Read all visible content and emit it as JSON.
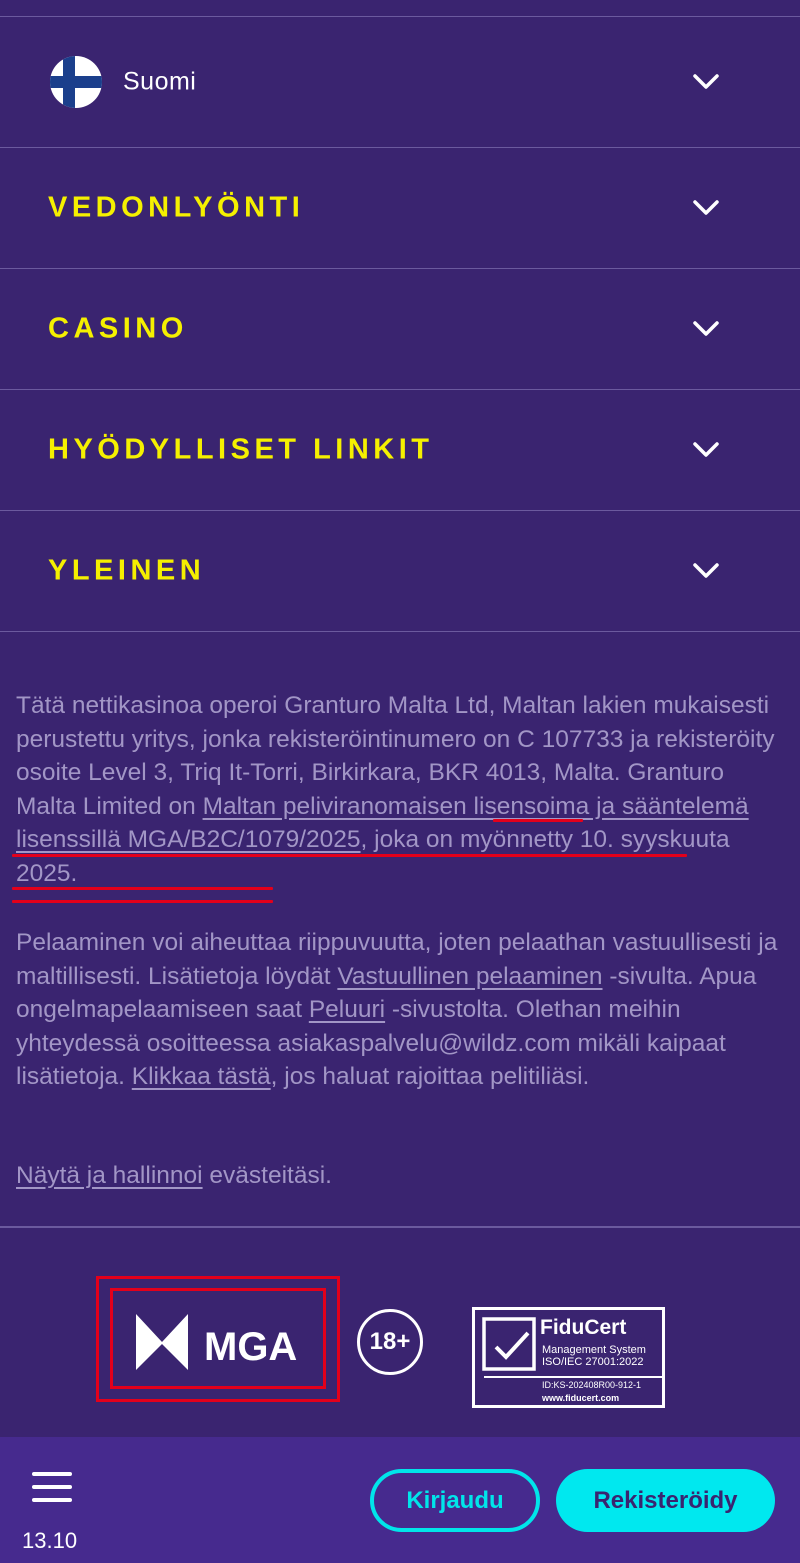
{
  "language": {
    "label": "Suomi",
    "flag_icon": "finland-flag-icon"
  },
  "accordion": [
    {
      "label": "VEDONLYÖNTI"
    },
    {
      "label": "CASINO"
    },
    {
      "label": "HYÖDYLLISET LINKIT"
    },
    {
      "label": "YLEINEN"
    }
  ],
  "info": {
    "p1_text_a": "Tätä nettikasinoa operoi Granturo Malta Ltd, Maltan lakien mukaisesti perustettu yritys, jonka rekisteröintinumero on C 107733 ja rekisteröity osoite Level 3, Triq It-Torri, Birkirkara, BKR 4013, Malta. Granturo Malta Limited on ",
    "p1_link": "Maltan peliviranomaisen lisensoima ja sääntelemä lisenssillä MGA/B2C/1079/2025",
    "p1_text_b": ", joka on myönnetty 10. syyskuuta 2025.",
    "p2_text_a": "Pelaaminen voi aiheuttaa riippuvuutta, joten pelaathan vastuullisesti ja maltillisesti. Lisätietoja löydät ",
    "p2_link1": "Vastuullinen pelaaminen",
    "p2_text_b": " -sivulta. Apua ongelmapelaamiseen saat ",
    "p2_link2": "Peluuri",
    "p2_text_c": " -sivustolta. Olethan meihin yhteydessä osoitteessa asiakaspalvelu@wildz.com mikäli kaipaat lisätietoja. ",
    "p2_link3": "Klikkaa tästä",
    "p2_text_d": ", jos haluat rajoittaa pelitiliäsi.",
    "p3_link": "Näytä ja hallinnoi",
    "p3_text": " evästeitäsi."
  },
  "badges": {
    "mga": "MGA",
    "age": "18+",
    "fiducert_title": "FiduCert",
    "fiducert_line1": "Management System",
    "fiducert_line2": "ISO/IEC 27001:2022",
    "fiducert_id": "ID:KS-202408R00-912-1",
    "fiducert_url": "www.fiducert.com"
  },
  "bottom_bar": {
    "version": "13.10",
    "login": "Kirjaudu",
    "register": "Rekisteröidy"
  },
  "colors": {
    "background": "#3a2470",
    "accent_yellow": "#f5f000",
    "accent_cyan": "#00e5ea",
    "annotation_red": "#e3001b"
  }
}
